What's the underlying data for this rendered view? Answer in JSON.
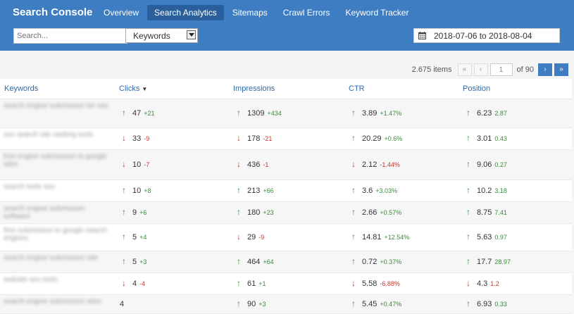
{
  "header": {
    "brand": "Search Console",
    "nav": [
      "Overview",
      "Search Analytics",
      "Sitemaps",
      "Crawl Errors",
      "Keyword Tracker"
    ],
    "active_nav": "Search Analytics",
    "search_placeholder": "Search...",
    "select_value": "Keywords",
    "date_range": "2018-07-06 to 2018-08-04"
  },
  "pager": {
    "items": "2.675 items",
    "first": "«",
    "prev": "‹",
    "page": "1",
    "of": "of 90",
    "next": "›",
    "last": "»"
  },
  "columns": [
    "Keywords",
    "Clicks",
    "Impressions",
    "CTR",
    "Position"
  ],
  "sort_indicator": "▼",
  "rows": [
    {
      "keyword": "search engine submission for seo",
      "clicks": {
        "dir": "up",
        "val": "47",
        "delta": "+21",
        "cls": "pos"
      },
      "impressions": {
        "dir": "up",
        "val": "1309",
        "delta": "+434",
        "cls": "pos"
      },
      "ctr": {
        "dir": "up",
        "val": "3.89",
        "delta": "+1.47%",
        "cls": "pos"
      },
      "position": {
        "dir": "up",
        "val": "6.23",
        "delta": "2.87",
        "cls": "plain"
      }
    },
    {
      "keyword": "seo search site ranking tools",
      "clicks": {
        "dir": "down",
        "val": "33",
        "delta": "-9",
        "cls": "neg"
      },
      "impressions": {
        "dir": "down",
        "val": "178",
        "delta": "-21",
        "cls": "neg"
      },
      "ctr": {
        "dir": "up",
        "val": "20.29",
        "delta": "+0.6%",
        "cls": "pos"
      },
      "position": {
        "dir": "up",
        "val": "3.01",
        "delta": "0.43",
        "cls": "plain"
      }
    },
    {
      "keyword": "free engine submission to google sites",
      "clicks": {
        "dir": "down",
        "val": "10",
        "delta": "-7",
        "cls": "neg"
      },
      "impressions": {
        "dir": "down",
        "val": "436",
        "delta": "-1",
        "cls": "neg"
      },
      "ctr": {
        "dir": "down",
        "val": "2.12",
        "delta": "-1.44%",
        "cls": "neg"
      },
      "position": {
        "dir": "up",
        "val": "9.06",
        "delta": "0.27",
        "cls": "plain"
      }
    },
    {
      "keyword": "search tools seo",
      "clicks": {
        "dir": "up",
        "val": "10",
        "delta": "+8",
        "cls": "pos"
      },
      "impressions": {
        "dir": "up",
        "val": "213",
        "delta": "+66",
        "cls": "pos"
      },
      "ctr": {
        "dir": "up",
        "val": "3.6",
        "delta": "+3.03%",
        "cls": "pos"
      },
      "position": {
        "dir": "up",
        "val": "10.2",
        "delta": "3.18",
        "cls": "plain"
      }
    },
    {
      "keyword": "search engine submission software",
      "clicks": {
        "dir": "up",
        "val": "9",
        "delta": "+6",
        "cls": "pos"
      },
      "impressions": {
        "dir": "up",
        "val": "180",
        "delta": "+23",
        "cls": "pos"
      },
      "ctr": {
        "dir": "up",
        "val": "2.66",
        "delta": "+0.57%",
        "cls": "pos"
      },
      "position": {
        "dir": "up",
        "val": "8.75",
        "delta": "7.41",
        "cls": "plain"
      }
    },
    {
      "keyword": "free submission to google search engines",
      "clicks": {
        "dir": "up",
        "val": "5",
        "delta": "+4",
        "cls": "pos"
      },
      "impressions": {
        "dir": "down",
        "val": "29",
        "delta": "-9",
        "cls": "neg"
      },
      "ctr": {
        "dir": "up",
        "val": "14.81",
        "delta": "+12.54%",
        "cls": "pos"
      },
      "position": {
        "dir": "up",
        "val": "5.63",
        "delta": "0.97",
        "cls": "plain"
      }
    },
    {
      "keyword": "search engine submission site",
      "clicks": {
        "dir": "up",
        "val": "5",
        "delta": "+3",
        "cls": "pos"
      },
      "impressions": {
        "dir": "up",
        "val": "464",
        "delta": "+64",
        "cls": "pos"
      },
      "ctr": {
        "dir": "up",
        "val": "0.72",
        "delta": "+0.37%",
        "cls": "pos"
      },
      "position": {
        "dir": "up",
        "val": "17.7",
        "delta": "28.97",
        "cls": "plain"
      }
    },
    {
      "keyword": "website seo tools",
      "clicks": {
        "dir": "down",
        "val": "4",
        "delta": "-4",
        "cls": "neg"
      },
      "impressions": {
        "dir": "up",
        "val": "61",
        "delta": "+1",
        "cls": "pos"
      },
      "ctr": {
        "dir": "down",
        "val": "5.58",
        "delta": "-6.88%",
        "cls": "neg"
      },
      "position": {
        "dir": "down",
        "val": "4.3",
        "delta": "1.2",
        "cls": "neg"
      }
    },
    {
      "keyword": "search engine submission sites",
      "clicks": {
        "dir": "none",
        "val": "4",
        "delta": "",
        "cls": "pos"
      },
      "impressions": {
        "dir": "up",
        "val": "90",
        "delta": "+3",
        "cls": "pos"
      },
      "ctr": {
        "dir": "up",
        "val": "5.45",
        "delta": "+0.47%",
        "cls": "pos"
      },
      "position": {
        "dir": "up",
        "val": "6.93",
        "delta": "0.33",
        "cls": "plain"
      }
    }
  ]
}
